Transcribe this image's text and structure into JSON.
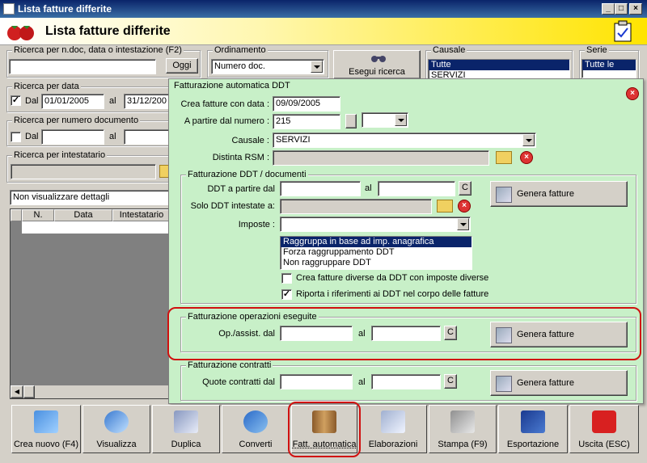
{
  "window": {
    "title": "Lista fatture differite"
  },
  "header": {
    "title": "Lista fatture differite"
  },
  "search_doc": {
    "label": "Ricerca per n.doc, data o intestazione (F2)",
    "value": "",
    "today_button": "Oggi"
  },
  "ordering": {
    "label": "Ordinamento",
    "value": "Numero doc."
  },
  "search_button": "Esegui ricerca",
  "causale_filter": {
    "label": "Causale",
    "items": [
      "Tutte",
      "SERVIZI"
    ]
  },
  "serie_filter": {
    "label": "Serie",
    "items": [
      "Tutte le serie"
    ]
  },
  "search_date": {
    "label": "Ricerca per data",
    "from_label": "Dal",
    "from": "01/01/2005",
    "to_label": "al",
    "to": "31/12/200"
  },
  "search_number": {
    "label": "Ricerca per numero documento",
    "from_label": "Dal",
    "to_label": "al"
  },
  "search_holder": {
    "label": "Ricerca per intestatario"
  },
  "details_combo": "Non visualizzare dettagli",
  "grid": {
    "columns": [
      "N.",
      "Data",
      "Intestatario"
    ]
  },
  "auto_panel": {
    "title": "Fatturazione automatica DDT",
    "create_date_label": "Crea fatture con data :",
    "create_date": "09/09/2005",
    "start_number_label": "A partire dal numero :",
    "start_number": "215",
    "causale_label": "Causale :",
    "causale": "SERVIZI",
    "distinta_label": "Distinta RSM :",
    "ddt_group": {
      "label": "Fatturazione DDT / documenti",
      "ddt_from_label": "DDT a partire dal",
      "to_label": "al",
      "c_button": "C",
      "solo_label": "Solo DDT intestate a:",
      "imposte_label": "Imposte :",
      "group_options": [
        "Raggruppa in base ad imp. anagrafica",
        "Forza raggruppamento DDT",
        "Non raggruppare DDT"
      ],
      "check_diverse": "Crea fatture diverse da DDT con imposte diverse",
      "check_riporta": "Riporta i riferimenti ai DDT nel corpo delle fatture",
      "generate_button": "Genera fatture"
    },
    "op_group": {
      "label": "Fatturazione operazioni eseguite",
      "from_label": "Op./assist. dal",
      "to_label": "al",
      "c_button": "C",
      "generate_button": "Genera fatture"
    },
    "contract_group": {
      "label": "Fatturazione contratti",
      "from_label": "Quote contratti dal",
      "to_label": "al",
      "c_button": "C",
      "generate_button": "Genera fatture"
    }
  },
  "toolbar": [
    {
      "label": "Crea nuovo (F4)",
      "icon": "new-icon"
    },
    {
      "label": "Visualizza",
      "icon": "view-icon"
    },
    {
      "label": "Duplica",
      "icon": "duplicate-icon"
    },
    {
      "label": "Converti",
      "icon": "convert-icon"
    },
    {
      "label": "Fatt. automatica",
      "icon": "folders-icon"
    },
    {
      "label": "Elaborazioni",
      "icon": "gear-icon"
    },
    {
      "label": "Stampa (F9)",
      "icon": "printer-icon"
    },
    {
      "label": "Esportazione",
      "icon": "floppy-icon"
    },
    {
      "label": "Uscita (ESC)",
      "icon": "power-icon"
    }
  ],
  "colors": {
    "panel_bg": "#c8f0c8",
    "highlight": "#d01010",
    "header_yellow": "#ffe400"
  }
}
